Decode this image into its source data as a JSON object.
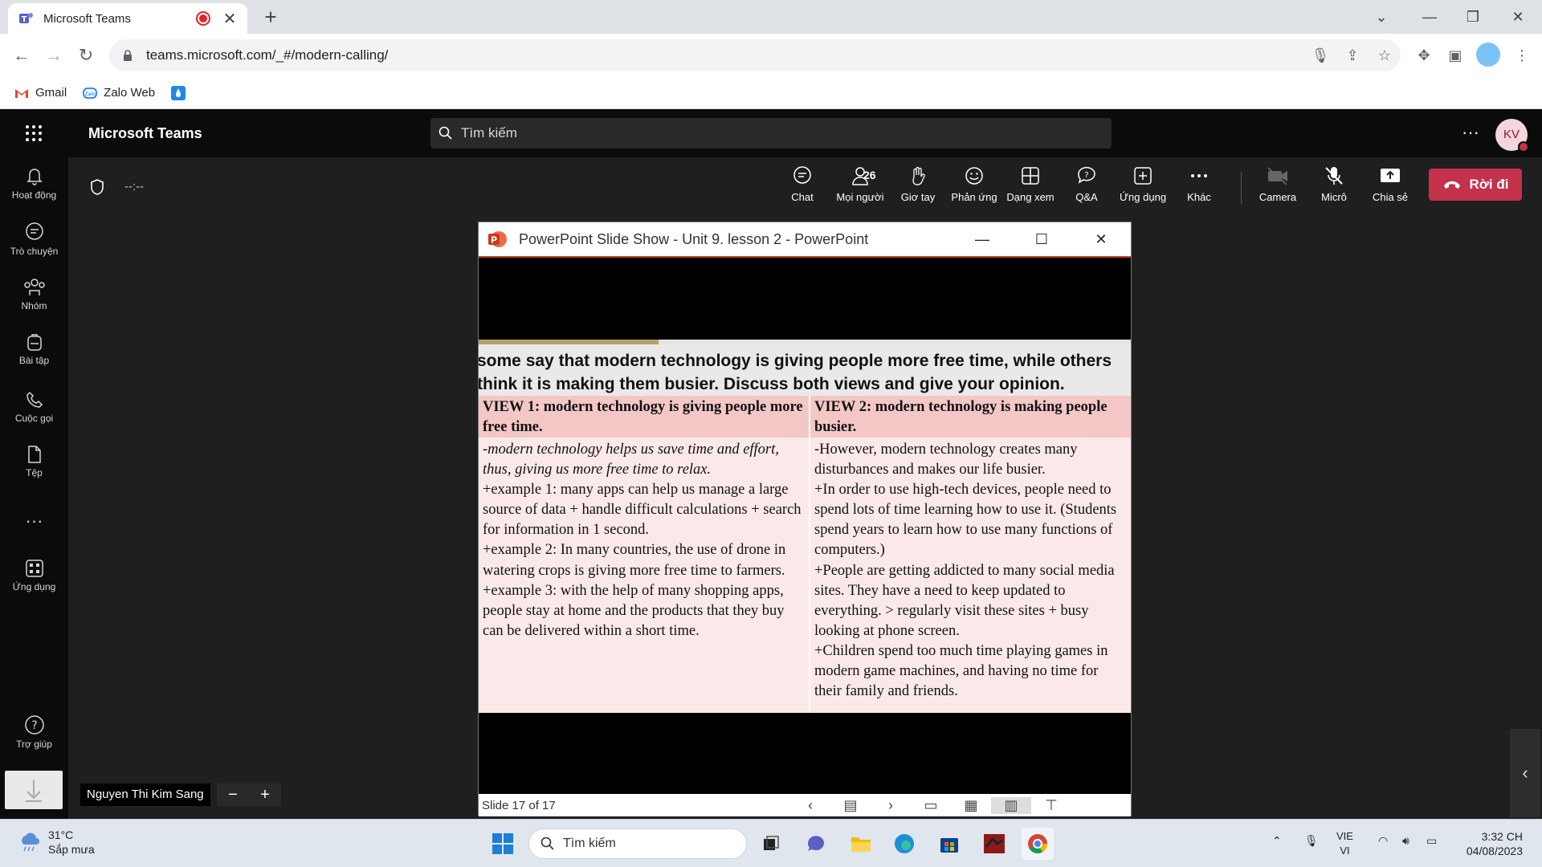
{
  "browser": {
    "tab_title": "Microsoft Teams",
    "url": "teams.microsoft.com/_#/modern-calling/",
    "bookmarks": [
      "Gmail",
      "Zalo Web"
    ]
  },
  "teams": {
    "app_name": "Microsoft Teams",
    "search_placeholder": "Tìm kiếm",
    "avatar_initials": "KV",
    "rail": [
      "Hoạt động",
      "Trò chuyện",
      "Nhóm",
      "Bài tập",
      "Cuộc gọi",
      "Tệp",
      "Ứng dụng",
      "Trợ giúp"
    ],
    "meeting_timer": "--:--",
    "controls": {
      "chat": "Chat",
      "people": "Mọi người",
      "people_count": "26",
      "raise_hand": "Giơ tay",
      "react": "Phản ứng",
      "view": "Dạng xem",
      "qa": "Q&A",
      "apps": "Ứng dụng",
      "more": "Khác",
      "camera": "Camera",
      "mic": "Micrô",
      "share": "Chia sẻ",
      "leave": "Rời đi"
    },
    "presenter_name": "Nguyen Thi Kim Sang"
  },
  "ppt": {
    "window_title": "PowerPoint Slide Show  -  Unit 9. lesson 2 - PowerPoint",
    "slide_status": "Slide 17 of 17",
    "question": "some say that modern technology is giving people more free time, while others think it is making them busier. Discuss both views and give your opinion.",
    "view1_heading": "VIEW 1: modern technology is giving people more free time.",
    "view1_intro": "-modern technology helps us save time and effort, thus, giving us more free time to relax.",
    "view1_body": [
      "+example 1: many apps can help us manage a large source of data + handle difficult calculations + search for information in 1 second.",
      "+example 2: In many countries, the use of drone in watering crops is giving more free time to farmers.",
      "+example 3: with the help of many shopping apps, people stay at home and the products that they buy can be delivered within a short time."
    ],
    "view2_heading": "VIEW 2: modern technology is making people busier.",
    "view2_body": [
      "-However, modern technology creates many disturbances and makes our life busier.",
      "+In order to use high-tech devices, people need to spend lots of time learning how to use it. (Students spend years to learn how to use many functions of  computers.)",
      "+People are getting addicted to many social media sites. They have a need to keep updated to everything. > regularly visit these sites + busy looking at phone screen.",
      "+Children spend too much time playing games in modern game machines, and having no time for their family and friends."
    ]
  },
  "taskbar": {
    "temperature": "31°C",
    "weather": "Sắp mưa",
    "search_placeholder": "Tìm kiếm",
    "lang_top": "VIE",
    "lang_bottom": "VI",
    "time": "3:32 CH",
    "date": "04/08/2023"
  },
  "colors": {
    "accent": "#c4314b",
    "teams_purple": "#5b5fc7",
    "ppt_orange": "#c43e1c"
  }
}
